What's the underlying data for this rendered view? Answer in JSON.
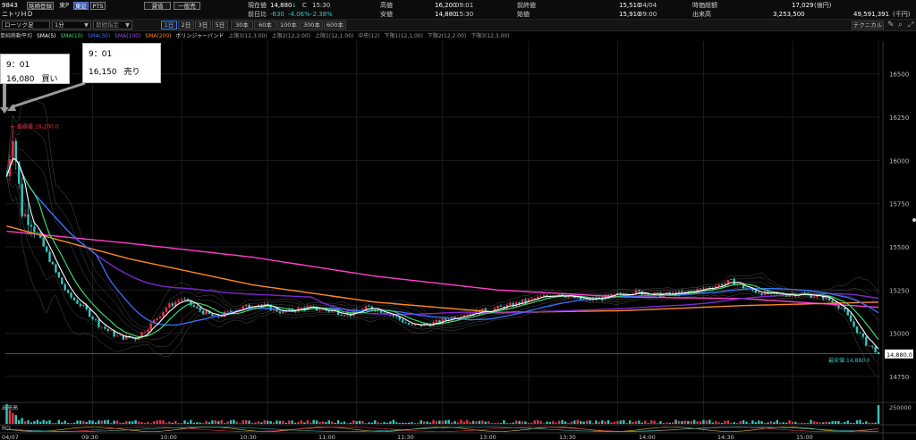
{
  "header": {
    "code": "9843",
    "register_label": "銘柄登録",
    "market": "東P",
    "market_tab_active": "東証",
    "market_tab_pts": "PTS",
    "name": "ニトリＨＤ",
    "credit_label": "貸借",
    "general_label": "一般売",
    "quote": {
      "current_label": "現在値",
      "current_value": "14,880",
      "current_arrow": "↓",
      "current_mark": "C",
      "current_time": "15:30",
      "prevday_label": "前日比",
      "prevday_change": "-630",
      "prevday_pct": "-4.06%",
      "prevday_pct2": "-2.38%",
      "high_label": "高値",
      "high_value": "16,200",
      "high_time": "09:01",
      "low_label": "安値",
      "low_value": "14,880",
      "low_time": "15:30",
      "prevclose_label": "前終値",
      "prevclose_value": "15,510",
      "prevclose_date": "04/04",
      "open_label": "始値",
      "open_value": "15,910",
      "open_time": "09:00",
      "mcap_label": "時価総額",
      "mcap_value": "17,029",
      "mcap_unit": "(億円)",
      "volume_label": "出来高",
      "volume_value": "3,253,500",
      "turnover_value": "49,591,391",
      "turnover_unit": "(千円)"
    }
  },
  "toolbar": {
    "chart_type": "ローソク足",
    "interval": "1分",
    "period_placeholder": "期間指定",
    "ranges": [
      "1日",
      "2日",
      "3日",
      "5日"
    ],
    "bars": [
      "30本",
      "60本",
      "100本",
      "300本",
      "600本"
    ],
    "technical_label": "テクニカル"
  },
  "indicators": {
    "title": "単純移動平均",
    "sma5": "SMA(5)",
    "sma10": "SMA(10)",
    "sma30": "SMA(30)",
    "sma100": "SMA(100)",
    "sma200": "SMA(200)",
    "bb_title": "ボリンジャーバンド",
    "bb_items": [
      "上限3(12,3.00)",
      "上限2(12,2.00)",
      "上限1(12,1.00)",
      "中央(12)",
      "下限1(12,1.00)",
      "下限2(12,2.00)",
      "下限3(12,3.00)"
    ]
  },
  "annotations": {
    "buy_time": "9：01",
    "buy_price": "16,080",
    "buy_side": "買い",
    "sell_time": "9：01",
    "sell_price": "16,150",
    "sell_side": "売り",
    "max_label": "最高値:16,200.0",
    "min_label": "最安値:14,880.0",
    "last_price_tag": "14,880.0"
  },
  "volume_panel": {
    "label": "出来高",
    "axis_label": "250000",
    "rci_label": "RCI"
  },
  "colors": {
    "up": "#e8344a",
    "down": "#35c6c0",
    "sma5": "#ffffff",
    "sma10": "#39d86a",
    "sma30": "#3a72ff",
    "sma100": "#7a28d0",
    "sma200": "#ff8a1e",
    "sma_pink": "#ff3fc8",
    "bb": "#8a8a8a"
  },
  "chart_data": {
    "type": "candlestick",
    "date_label": "04/07",
    "y_ticks": [
      14750,
      15000,
      15250,
      15500,
      15750,
      16000,
      16250,
      16500
    ],
    "x_ticks": [
      "09:30",
      "10:00",
      "10:30",
      "11:00",
      "11:30",
      "13:00",
      "13:30",
      "14:00",
      "14:30",
      "15:00"
    ],
    "ylim": [
      14620,
      16690
    ],
    "last_price": 14880,
    "high": 16200,
    "low": 14880,
    "path_anchors": [
      [
        0,
        15910
      ],
      [
        2,
        16150
      ],
      [
        5,
        15700
      ],
      [
        8,
        15650
      ],
      [
        12,
        15500
      ],
      [
        16,
        15350
      ],
      [
        20,
        15220
      ],
      [
        25,
        15150
      ],
      [
        30,
        15050
      ],
      [
        36,
        14980
      ],
      [
        42,
        14970
      ],
      [
        47,
        15050
      ],
      [
        52,
        15150
      ],
      [
        57,
        15200
      ],
      [
        62,
        15140
      ],
      [
        68,
        15090
      ],
      [
        75,
        15140
      ],
      [
        82,
        15170
      ],
      [
        90,
        15120
      ],
      [
        97,
        15150
      ],
      [
        105,
        15130
      ],
      [
        112,
        15110
      ],
      [
        118,
        15150
      ],
      [
        124,
        15120
      ],
      [
        132,
        15040
      ],
      [
        140,
        15060
      ],
      [
        148,
        15110
      ],
      [
        156,
        15130
      ],
      [
        164,
        15160
      ],
      [
        172,
        15200
      ],
      [
        180,
        15230
      ],
      [
        188,
        15190
      ],
      [
        196,
        15210
      ],
      [
        204,
        15240
      ],
      [
        212,
        15220
      ],
      [
        220,
        15230
      ],
      [
        228,
        15260
      ],
      [
        236,
        15300
      ],
      [
        242,
        15250
      ],
      [
        250,
        15220
      ],
      [
        258,
        15230
      ],
      [
        266,
        15210
      ],
      [
        272,
        15150
      ],
      [
        276,
        15040
      ],
      [
        280,
        14940
      ],
      [
        284,
        14890
      ]
    ],
    "sma200_anchors": [
      [
        0,
        15620
      ],
      [
        40,
        15430
      ],
      [
        80,
        15280
      ],
      [
        120,
        15180
      ],
      [
        160,
        15120
      ],
      [
        200,
        15130
      ],
      [
        240,
        15160
      ],
      [
        284,
        15180
      ]
    ],
    "sma_pink_anchors": [
      [
        0,
        15590
      ],
      [
        40,
        15520
      ],
      [
        80,
        15440
      ],
      [
        120,
        15330
      ],
      [
        160,
        15250
      ],
      [
        200,
        15210
      ],
      [
        240,
        15200
      ],
      [
        284,
        15150
      ]
    ],
    "volume_spikes": [
      [
        0,
        1.0
      ],
      [
        1,
        0.7
      ],
      [
        2,
        0.55
      ],
      [
        3,
        0.45
      ],
      [
        5,
        0.3
      ],
      [
        284,
        0.95
      ]
    ]
  }
}
